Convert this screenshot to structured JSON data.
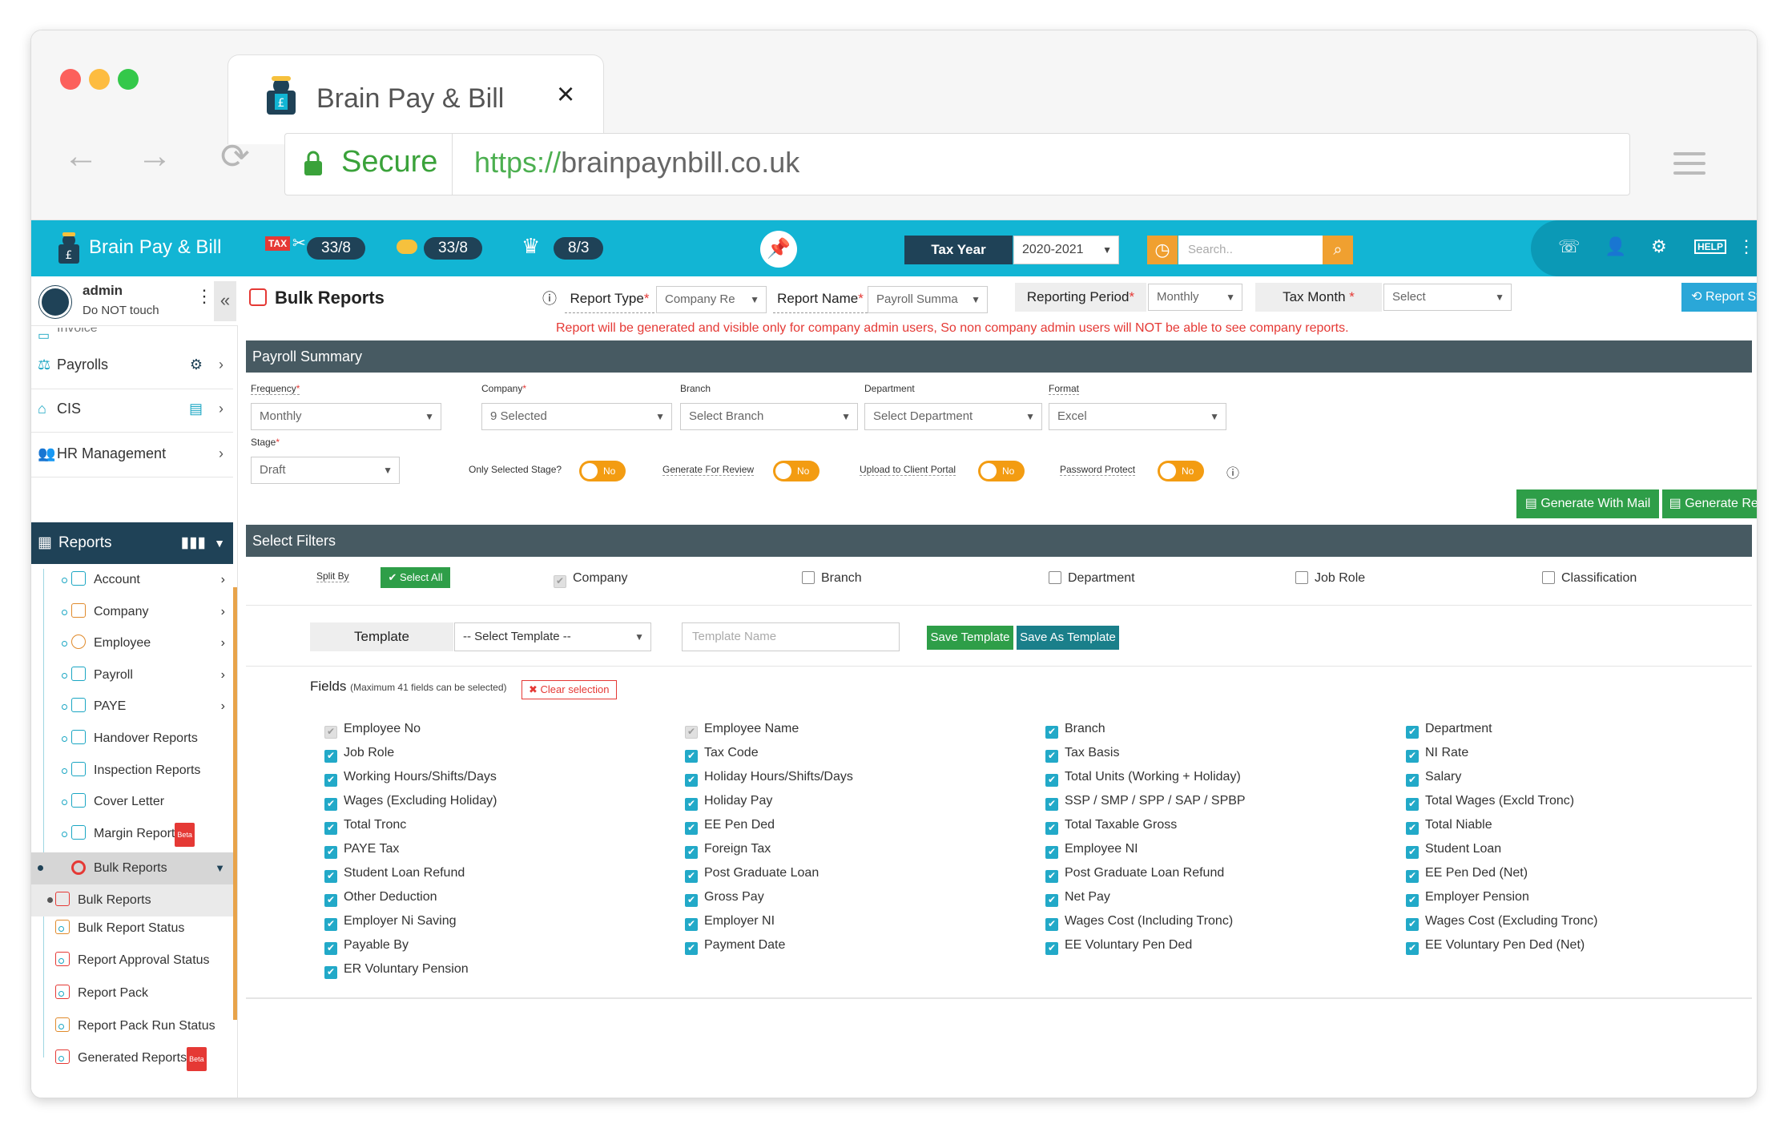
{
  "browser": {
    "tab_title": "Brain Pay & Bill",
    "tab_close": "×",
    "secure_label": "Secure",
    "url_scheme": "https://",
    "url_host": "brainpaynbill.co.uk"
  },
  "appbar": {
    "brand": "Brain Pay & Bill",
    "tax_label": "TAX",
    "tax_count": "33/8",
    "coin_count": "33/8",
    "crown_count": "8/3",
    "tax_year_label": "Tax Year",
    "tax_year_value": "2020-2021",
    "search_placeholder": "Search.."
  },
  "user": {
    "name": "admin",
    "subtitle": "Do NOT touch"
  },
  "sidebar": {
    "partial_item": "Invoice",
    "top": [
      {
        "label": "Payrolls"
      },
      {
        "label": "CIS"
      },
      {
        "label": "HR Management"
      }
    ],
    "reports_label": "Reports",
    "subs": [
      {
        "label": "Account"
      },
      {
        "label": "Company"
      },
      {
        "label": "Employee"
      },
      {
        "label": "Payroll"
      },
      {
        "label": "PAYE"
      },
      {
        "label": "Handover Reports"
      },
      {
        "label": "Inspection Reports"
      },
      {
        "label": "Cover Letter"
      },
      {
        "label": "Margin Report"
      },
      {
        "label": "Bulk Reports"
      }
    ],
    "bulk_subs": [
      {
        "label": "Bulk Reports"
      },
      {
        "label": "Bulk Report Status"
      },
      {
        "label": "Report Approval Status"
      },
      {
        "label": "Report Pack"
      },
      {
        "label": "Report Pack Run Status"
      },
      {
        "label": "Generated Reports"
      }
    ],
    "beta": "Beta"
  },
  "page": {
    "title": "Bulk Reports",
    "report_type_label": "Report Type",
    "report_type_value": "Company Re",
    "report_name_label": "Report Name",
    "report_name_value": "Payroll Summa",
    "reporting_period_label": "Reporting Period",
    "reporting_period_value": "Monthly",
    "tax_month_label": "Tax Month",
    "tax_month_value": "Select",
    "report_status_btn": "Report Status",
    "warning": "Report will be generated and visible only for company admin users, So non company admin users will NOT be able to see company reports.",
    "section1": "Payroll Summary",
    "frequency_label": "Frequency",
    "frequency_value": "Monthly",
    "company_label": "Company",
    "company_value": "9 Selected",
    "branch_label": "Branch",
    "branch_value": "Select Branch",
    "department_label": "Department",
    "department_value": "Select Department",
    "format_label": "Format",
    "format_value": "Excel",
    "stage_label": "Stage",
    "stage_value": "Draft",
    "only_selected_stage": "Only Selected Stage?",
    "generate_for_review": "Generate For Review",
    "upload_client_portal": "Upload to Client Portal",
    "password_protect": "Password Protect",
    "toggle_no": "No",
    "gen_mail_btn": "Generate With Mail",
    "gen_report_btn": "Generate Report",
    "section2": "Select Filters",
    "split_by": "Split By",
    "select_all": "Select All",
    "split_options": [
      "Company",
      "Branch",
      "Department",
      "Job Role",
      "Classification"
    ],
    "template_label": "Template",
    "template_select": "-- Select Template --",
    "template_name_placeholder": "Template Name",
    "save_template": "Save Template",
    "save_as_template": "Save As Template",
    "fields_label": "Fields",
    "fields_note": "(Maximum 41 fields can be selected)",
    "clear_selection": "Clear selection"
  },
  "fields": [
    [
      "Employee No",
      "Job Role",
      "Working Hours/Shifts/Days",
      "Wages (Excluding Holiday)",
      "Total Tronc",
      "PAYE Tax",
      "Student Loan Refund",
      "Other Deduction",
      "Employer Ni Saving",
      "Payable By",
      "ER Voluntary Pension"
    ],
    [
      "Employee Name",
      "Tax Code",
      "Holiday Hours/Shifts/Days",
      "Holiday Pay",
      "EE Pen Ded",
      "Foreign Tax",
      "Post Graduate Loan",
      "Gross Pay",
      "Employer NI",
      "Payment Date"
    ],
    [
      "Branch",
      "Tax Basis",
      "Total Units (Working + Holiday)",
      "SSP / SMP / SPP / SAP / SPBP",
      "Total Taxable Gross",
      "Employee NI",
      "Post Graduate Loan Refund",
      "Net Pay",
      "Wages Cost (Including Tronc)",
      "EE Voluntary Pen Ded"
    ],
    [
      "Department",
      "NI Rate",
      "Salary",
      "Total Wages (Excld Tronc)",
      "Total Niable",
      "Student Loan",
      "EE Pen Ded (Net)",
      "Employer Pension",
      "Wages Cost (Excluding Tronc)",
      "EE Voluntary Pen Ded (Net)"
    ]
  ],
  "colors": {
    "appbar": "#12b5d4",
    "navy": "#1f4257",
    "green": "#2e9e48",
    "orange": "#f39c12",
    "red": "#e53935"
  }
}
